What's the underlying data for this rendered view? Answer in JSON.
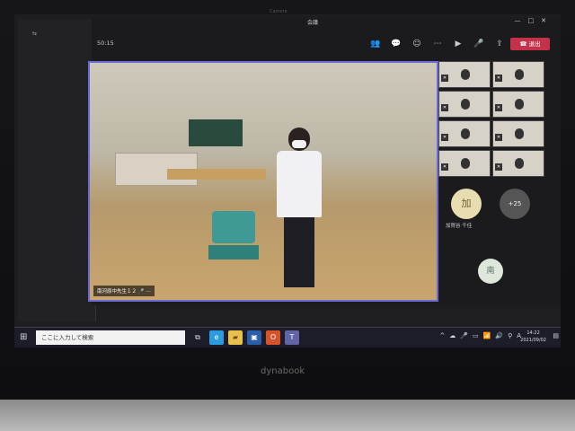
{
  "device": {
    "camera_label": "Camera",
    "brand": "dynabook"
  },
  "window": {
    "title": "会議",
    "controls": [
      "—",
      "□",
      "✕"
    ]
  },
  "meeting": {
    "timer": "50:15",
    "toolbar": [
      {
        "name": "participants-icon",
        "glyph": "👥"
      },
      {
        "name": "chat-icon",
        "glyph": "💬"
      },
      {
        "name": "reactions-icon",
        "glyph": "☺"
      },
      {
        "name": "more-icon",
        "glyph": "⋯"
      },
      {
        "name": "camera-icon",
        "glyph": "▶"
      },
      {
        "name": "mic-off-icon",
        "glyph": "🎤"
      },
      {
        "name": "share-icon",
        "glyph": "⇪"
      }
    ],
    "leave_label": "退出",
    "main_video_name": "南河原中先生１２",
    "more_participants": "+25",
    "avatar_big": "加",
    "avatar_labels": "加賀谷 千佳",
    "avatar_small": "南"
  },
  "taskbar": {
    "search_placeholder": "ここに入力して検索",
    "apps": [
      {
        "name": "task-view-icon",
        "glyph": "⧉",
        "color": "#1d1d2a"
      },
      {
        "name": "edge-icon",
        "glyph": "e",
        "color": "#2b9be0"
      },
      {
        "name": "explorer-icon",
        "glyph": "▰",
        "color": "#e8c14a"
      },
      {
        "name": "store-icon",
        "glyph": "▣",
        "color": "#2a5ea8"
      },
      {
        "name": "office-icon",
        "glyph": "O",
        "color": "#d4532b"
      },
      {
        "name": "teams-icon",
        "glyph": "T",
        "color": "#6264a7"
      }
    ],
    "tray_icons": [
      "^",
      "☁",
      "🎤",
      "▭",
      "📶",
      "🔊",
      "⚲",
      "A"
    ],
    "time": "14:22",
    "date": "2021/09/02"
  }
}
